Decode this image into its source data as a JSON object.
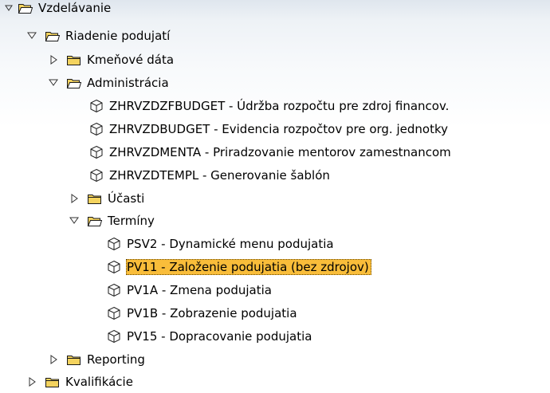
{
  "tree": {
    "nodes": [
      {
        "label": "Vzdelávanie",
        "state": "expanded",
        "type": "folder"
      },
      {
        "label": "Riadenie podujatí",
        "state": "expanded",
        "type": "folder"
      },
      {
        "label": "Kmeňové dáta",
        "state": "collapsed",
        "type": "folder"
      },
      {
        "label": "Administrácia",
        "state": "expanded",
        "type": "folder"
      },
      {
        "label": "ZHRVZDZFBUDGET - Údržba rozpočtu pre zdroj financov.",
        "type": "transaction"
      },
      {
        "label": "ZHRVZDBUDGET - Evidencia rozpočtov pre org. jednotky",
        "type": "transaction"
      },
      {
        "label": "ZHRVZDMENTA - Priradzovanie mentorov zamestnancom",
        "type": "transaction"
      },
      {
        "label": "ZHRVZDTEMPL - Generovanie šablón",
        "type": "transaction"
      },
      {
        "label": "Účasti",
        "state": "collapsed",
        "type": "folder"
      },
      {
        "label": "Termíny",
        "state": "expanded",
        "type": "folder"
      },
      {
        "label": "PSV2 - Dynamické menu podujatia",
        "type": "transaction"
      },
      {
        "label": "PV11 - Založenie podujatia (bez zdrojov)",
        "type": "transaction",
        "selected": true
      },
      {
        "label": "PV1A - Zmena podujatia",
        "type": "transaction"
      },
      {
        "label": "PV1B - Zobrazenie podujatia",
        "type": "transaction"
      },
      {
        "label": "PV15 - Dopracovanie podujatia",
        "type": "transaction"
      },
      {
        "label": "Reporting",
        "state": "collapsed",
        "type": "folder"
      },
      {
        "label": "Kvalifikácie",
        "state": "collapsed",
        "type": "folder"
      }
    ]
  },
  "colors": {
    "selection_bg": "#f9bd3a",
    "folder_fill": "#f4d35e",
    "folder_outline": "#1a1a1a",
    "toggle_color": "#333333"
  }
}
